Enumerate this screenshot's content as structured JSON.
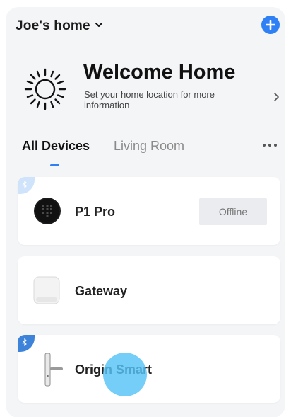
{
  "header": {
    "home_name": "Joe's  home",
    "chevron_icon": "chevron-down-icon",
    "add_icon": "plus-circle-icon",
    "accent_color": "#2f7ff5"
  },
  "welcome": {
    "title": "Welcome Home",
    "subtitle": "Set your home location for more information",
    "icon": "sun-icon",
    "arrow_icon": "chevron-right-icon"
  },
  "tabs": [
    {
      "label": "All Devices",
      "active": true
    },
    {
      "label": "Living Room",
      "active": false
    }
  ],
  "more_icon": "more-horizontal-icon",
  "devices": [
    {
      "name": "P1 Pro",
      "status": "Offline",
      "bluetooth": true,
      "icon": "keypad-lock-icon"
    },
    {
      "name": "Gateway",
      "status": "",
      "bluetooth": false,
      "icon": "gateway-icon"
    },
    {
      "name": "Origin Smart",
      "status": "",
      "bluetooth": true,
      "icon": "lever-handle-icon"
    }
  ]
}
